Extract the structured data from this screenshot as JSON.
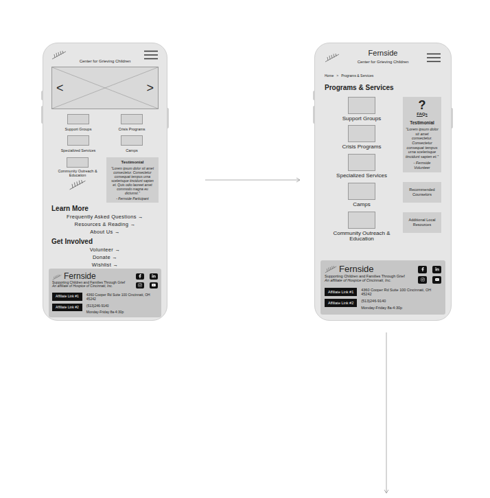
{
  "home_screen": {
    "header": {
      "subtitle": "Center for Grieving Children"
    },
    "carousel": {
      "prev": "<",
      "next": ">"
    },
    "programs": [
      {
        "label": "Support Groups"
      },
      {
        "label": "Crisis Programs"
      },
      {
        "label": "Specialized Services"
      },
      {
        "label": "Camps"
      }
    ],
    "community": {
      "label": "Community Outreach & Education"
    },
    "testimonial": {
      "title": "Testimonial",
      "quote": "\"Lorem ipsum dolor sit amet consectetur. Consectetur consequat tempus urna scelerisque tincidunt sapien et. Quis odio laoreet amet commodo magna eu dictumst.\"",
      "author": "- Fernside Participant"
    },
    "sections": [
      {
        "heading": "Learn More",
        "links": [
          {
            "label": "Frequently Asked Questions",
            "arrow": "→"
          },
          {
            "label": "Resources & Reading",
            "arrow": "→"
          },
          {
            "label": "About Us",
            "arrow": "→"
          }
        ]
      },
      {
        "heading": "Get Involved",
        "links": [
          {
            "label": "Volunteer",
            "arrow": "→"
          },
          {
            "label": "Donate",
            "arrow": "→"
          },
          {
            "label": "Wishlist",
            "arrow": "→"
          }
        ]
      }
    ]
  },
  "programs_screen": {
    "header": {
      "brand": "Fernside",
      "subtitle": "Center for Grieving Children"
    },
    "breadcrumb": {
      "items": [
        "Home",
        "Programs & Services"
      ],
      "separator": ">"
    },
    "title": "Programs & Services",
    "programs": [
      {
        "label": "Support Groups"
      },
      {
        "label": "Crisis Programs"
      },
      {
        "label": "Specialized Services"
      },
      {
        "label": "Camps"
      },
      {
        "label": "Community Outreach & Education"
      }
    ],
    "faq": {
      "icon": "?",
      "label": "FAQs"
    },
    "testimonial": {
      "title": "Testimonial",
      "quote": "\"Lorem ipsum dolor sit amet consectetur. Consectetur consequat tempus urna scelerisque tincidunt sapien et.\"",
      "author": "- Fernside Volunteer"
    },
    "side_links": [
      {
        "label": "Recommended Counselors"
      },
      {
        "label": "Additional Local Resources"
      }
    ]
  },
  "footer": {
    "brand": "Fernside",
    "tagline": "Supporting Children and Families Through Grief",
    "affiliate": "An affiliate of Hospice of Cincinnati, Inc.",
    "links": [
      "Affiliate Link #1",
      "Affiliate Link #2"
    ],
    "address": "4360 Cooper Rd Suite 100 Cincinnati, OH 45242",
    "phone": "(513)246-9140",
    "hours": "Monday-Friday 8a-4:30p"
  }
}
